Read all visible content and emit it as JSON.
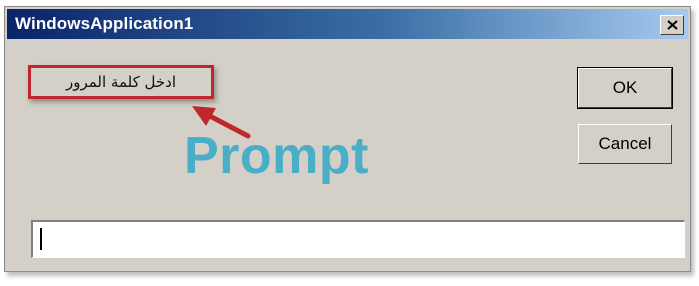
{
  "window": {
    "title": "WindowsApplication1",
    "close_icon": "close-icon"
  },
  "prompt": {
    "text": "ادخل كلمة المرور"
  },
  "annotation": {
    "label": "Prompt",
    "highlight_color": "#c0272d",
    "label_color": "#4aaec8",
    "arrow_icon": "red-arrow-icon"
  },
  "buttons": {
    "ok_label": "OK",
    "cancel_label": "Cancel"
  },
  "input": {
    "value": "",
    "placeholder": ""
  },
  "colors": {
    "dialog_bg": "#d4d0c8",
    "title_gradient_start": "#0a246a",
    "title_gradient_end": "#a6caf0"
  }
}
